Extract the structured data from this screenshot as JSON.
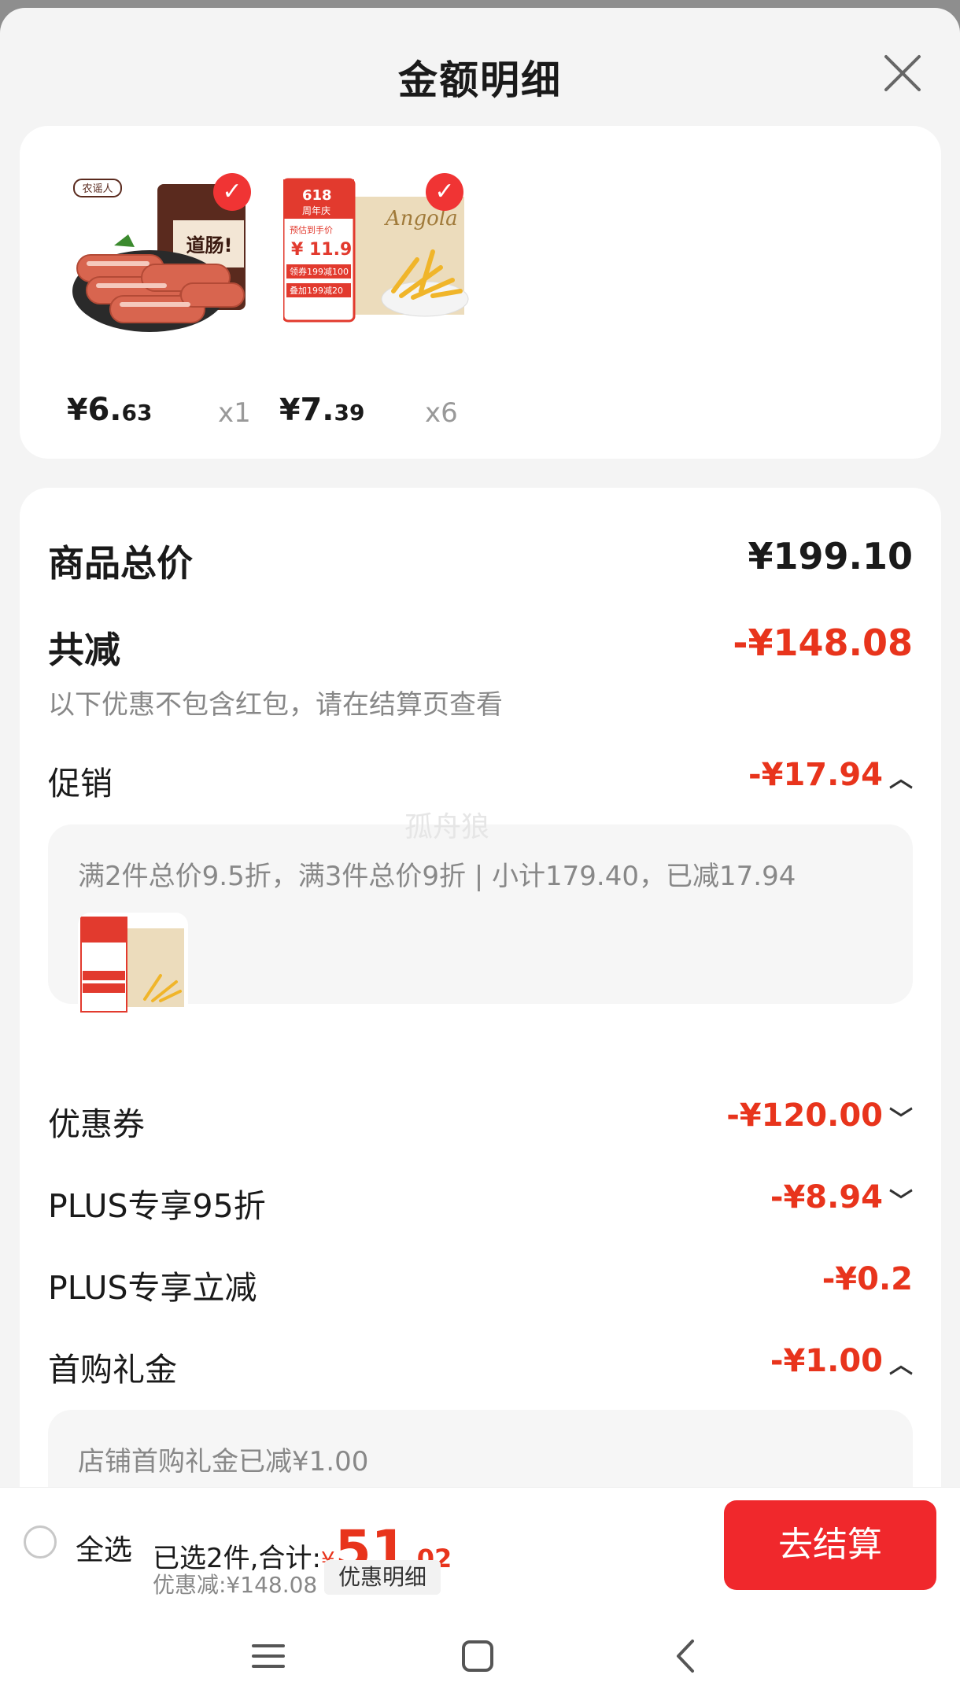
{
  "header": {
    "title": "金额明细",
    "close_icon": "close-icon"
  },
  "products": [
    {
      "name": "sausage",
      "price_symbol": "¥",
      "price_int": "6.",
      "price_dec": "63",
      "qty": "x1",
      "selected": true
    },
    {
      "name": "fries",
      "price_symbol": "¥",
      "price_int": "7.",
      "price_dec": "39",
      "qty": "x6",
      "selected": true
    }
  ],
  "product_image_texts": {
    "sausage_brand": "农谣人",
    "sausage_pack": "道肠!",
    "fries_badge_top": "618",
    "fries_badge_sub": "周年庆",
    "fries_badge_label": "预估到手价",
    "fries_badge_price": "¥ 11.9",
    "fries_coupon1": "领券199减100",
    "fries_coupon2": "叠加199减20",
    "fries_brand": "Angola"
  },
  "totals": {
    "goods_total_label": "商品总价",
    "goods_total_value": "¥199.10",
    "total_reduce_label": "共减",
    "total_reduce_value": "-¥148.08",
    "note": "以下优惠不包含红包，请在结算页查看"
  },
  "promo": {
    "label": "促销",
    "value": "-¥17.94",
    "detail": "满2件总价9.5折，满3件总价9折 | 小计179.40，已减17.94"
  },
  "watermark": "孤舟狼",
  "coupon": {
    "label": "优惠券",
    "value": "-¥120.00"
  },
  "plus_discount": {
    "label": "PLUS专享95折",
    "value": "-¥8.94"
  },
  "plus_reduce": {
    "label": "PLUS专享立减",
    "value": "-¥0.2"
  },
  "first_gift": {
    "label": "首购礼金",
    "value": "-¥1.00",
    "detail": "店铺首购礼金已减¥1.00"
  },
  "bottom": {
    "select_all": "全选",
    "summary_prefix": "已选2件,合计:",
    "total_symbol": "¥",
    "total_int": "51",
    "total_dec": ".02",
    "discount_text": "优惠减:¥148.08",
    "detail_link": "优惠明细",
    "checkout": "去结算"
  },
  "colors": {
    "accent": "#f0282c",
    "price_red": "#e8341c"
  }
}
